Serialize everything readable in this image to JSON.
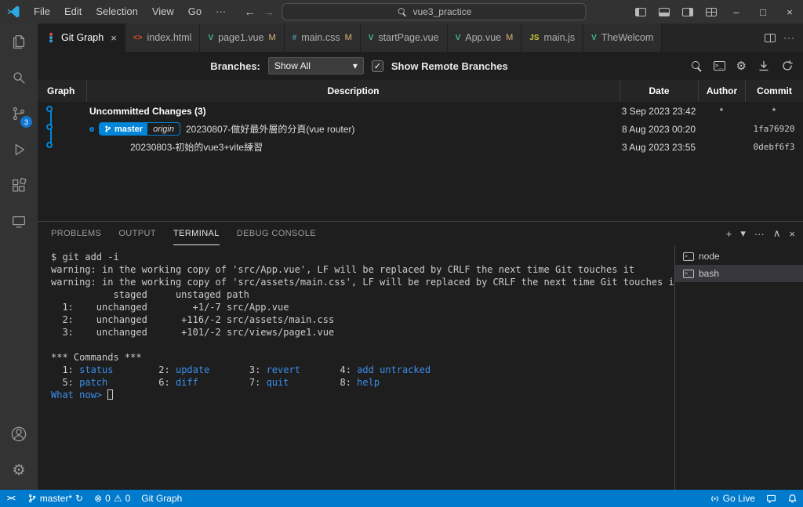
{
  "titlebar": {
    "menus": [
      "File",
      "Edit",
      "Selection",
      "View",
      "Go"
    ],
    "menus_more": "···",
    "search_value": "vue3_practice"
  },
  "tabs": [
    {
      "label": "Git Graph"
    },
    {
      "label": "index.html",
      "icon": "<>"
    },
    {
      "label": "page1.vue",
      "icon": "V",
      "badge": "M"
    },
    {
      "label": "main.css",
      "icon": "#",
      "badge": "M"
    },
    {
      "label": "startPage.vue",
      "icon": "V"
    },
    {
      "label": "App.vue",
      "icon": "V",
      "badge": "M"
    },
    {
      "label": "main.js",
      "icon": "JS"
    },
    {
      "label": "TheWelcom",
      "icon": "V"
    }
  ],
  "gitgraph": {
    "branches_label": "Branches:",
    "branches_value": "Show All",
    "remote_checkbox_label": "Show Remote Branches",
    "columns": {
      "graph": "Graph",
      "description": "Description",
      "date": "Date",
      "author": "Author",
      "commit": "Commit"
    },
    "rows": [
      {
        "description": "Uncommitted Changes (3)",
        "date": "3 Sep 2023 23:42",
        "author": "*",
        "commit": "*"
      },
      {
        "branch": "master",
        "remote": "origin",
        "description": "20230807-做好最外層的分頁(vue router)",
        "date": "8 Aug 2023 00:20",
        "commit": "1fa76920"
      },
      {
        "description": "20230803-初始的vue3+vite練習",
        "date": "3 Aug 2023 23:55",
        "commit": "0debf6f3"
      }
    ],
    "accent_color": "#0085d9"
  },
  "panel": {
    "tabs": [
      "PROBLEMS",
      "OUTPUT",
      "TERMINAL",
      "DEBUG CONSOLE"
    ],
    "active_tab": "TERMINAL",
    "terminal_lines": [
      [
        {
          "t": "$ git add -i"
        }
      ],
      [
        {
          "t": "warning: in the working copy of 'src/App.vue', LF will be replaced by CRLF the next time Git touches it"
        }
      ],
      [
        {
          "t": "warning: in the working copy of 'src/assets/main.css', LF will be replaced by CRLF the next time Git touches it"
        }
      ],
      [
        {
          "t": "           staged     unstaged path"
        }
      ],
      [
        {
          "t": "  1:    unchanged        +1/-7 src/App.vue"
        }
      ],
      [
        {
          "t": "  2:    unchanged      +116/-2 src/assets/main.css"
        }
      ],
      [
        {
          "t": "  3:    unchanged      +101/-2 src/views/page1.vue"
        }
      ],
      [],
      [
        {
          "t": "*** Commands ***"
        }
      ],
      [
        {
          "t": "  1: "
        },
        {
          "t": "status",
          "c": "b"
        },
        {
          "t": "        2: "
        },
        {
          "t": "update",
          "c": "b"
        },
        {
          "t": "       3: "
        },
        {
          "t": "revert",
          "c": "b"
        },
        {
          "t": "       4: "
        },
        {
          "t": "add untracked",
          "c": "b"
        }
      ],
      [
        {
          "t": "  5: "
        },
        {
          "t": "patch",
          "c": "b"
        },
        {
          "t": "         6: "
        },
        {
          "t": "diff",
          "c": "b"
        },
        {
          "t": "         7: "
        },
        {
          "t": "quit",
          "c": "b"
        },
        {
          "t": "         8: "
        },
        {
          "t": "help",
          "c": "b"
        }
      ],
      [
        {
          "t": "What now> ",
          "c": "b"
        },
        {
          "cursor": true
        }
      ]
    ],
    "terminals": [
      {
        "label": "node"
      },
      {
        "label": "bash"
      }
    ]
  },
  "statusbar": {
    "remote": "><",
    "branch": "master*",
    "errors": "0",
    "warnings": "0",
    "gitgraph_label": "Git Graph",
    "golive_label": "Go Live"
  },
  "glyphs": {
    "back": "←",
    "forward": "→",
    "minimize": "–",
    "maximize": "□",
    "close": "×",
    "more": "···",
    "plus": "+",
    "caret_down": "▾",
    "chevron_up": "∧",
    "gear": "⚙",
    "check": "✓",
    "error": "⊗",
    "warning": "⚠",
    "sync": "↻",
    "term": ">_"
  }
}
